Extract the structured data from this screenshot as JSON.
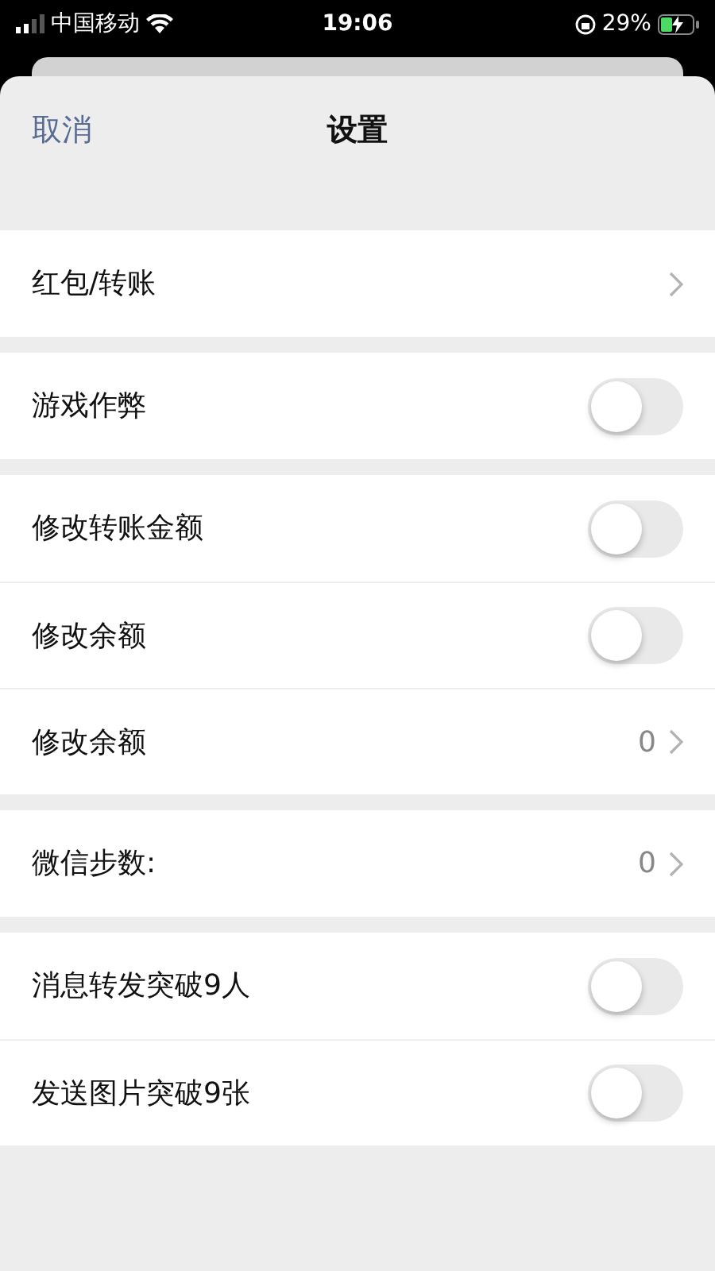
{
  "status_bar": {
    "carrier": "中国移动",
    "time": "19:06",
    "battery": "29%"
  },
  "header": {
    "cancel": "取消",
    "title": "设置"
  },
  "groups": [
    {
      "rows": [
        {
          "kind": "link",
          "label": "红包/转账"
        }
      ]
    },
    {
      "rows": [
        {
          "kind": "toggle",
          "label": "游戏作弊",
          "on": false
        }
      ]
    },
    {
      "rows": [
        {
          "kind": "toggle",
          "label": "修改转账金额",
          "on": false
        },
        {
          "kind": "toggle",
          "label": "修改余额",
          "on": false
        },
        {
          "kind": "link",
          "label": "修改余额",
          "value": "0"
        }
      ]
    },
    {
      "rows": [
        {
          "kind": "link",
          "label": "微信步数:",
          "value": "0"
        }
      ]
    },
    {
      "rows": [
        {
          "kind": "toggle",
          "label": "消息转发突破9人",
          "on": false
        },
        {
          "kind": "toggle",
          "label": "发送图片突破9张",
          "on": false
        }
      ]
    }
  ]
}
